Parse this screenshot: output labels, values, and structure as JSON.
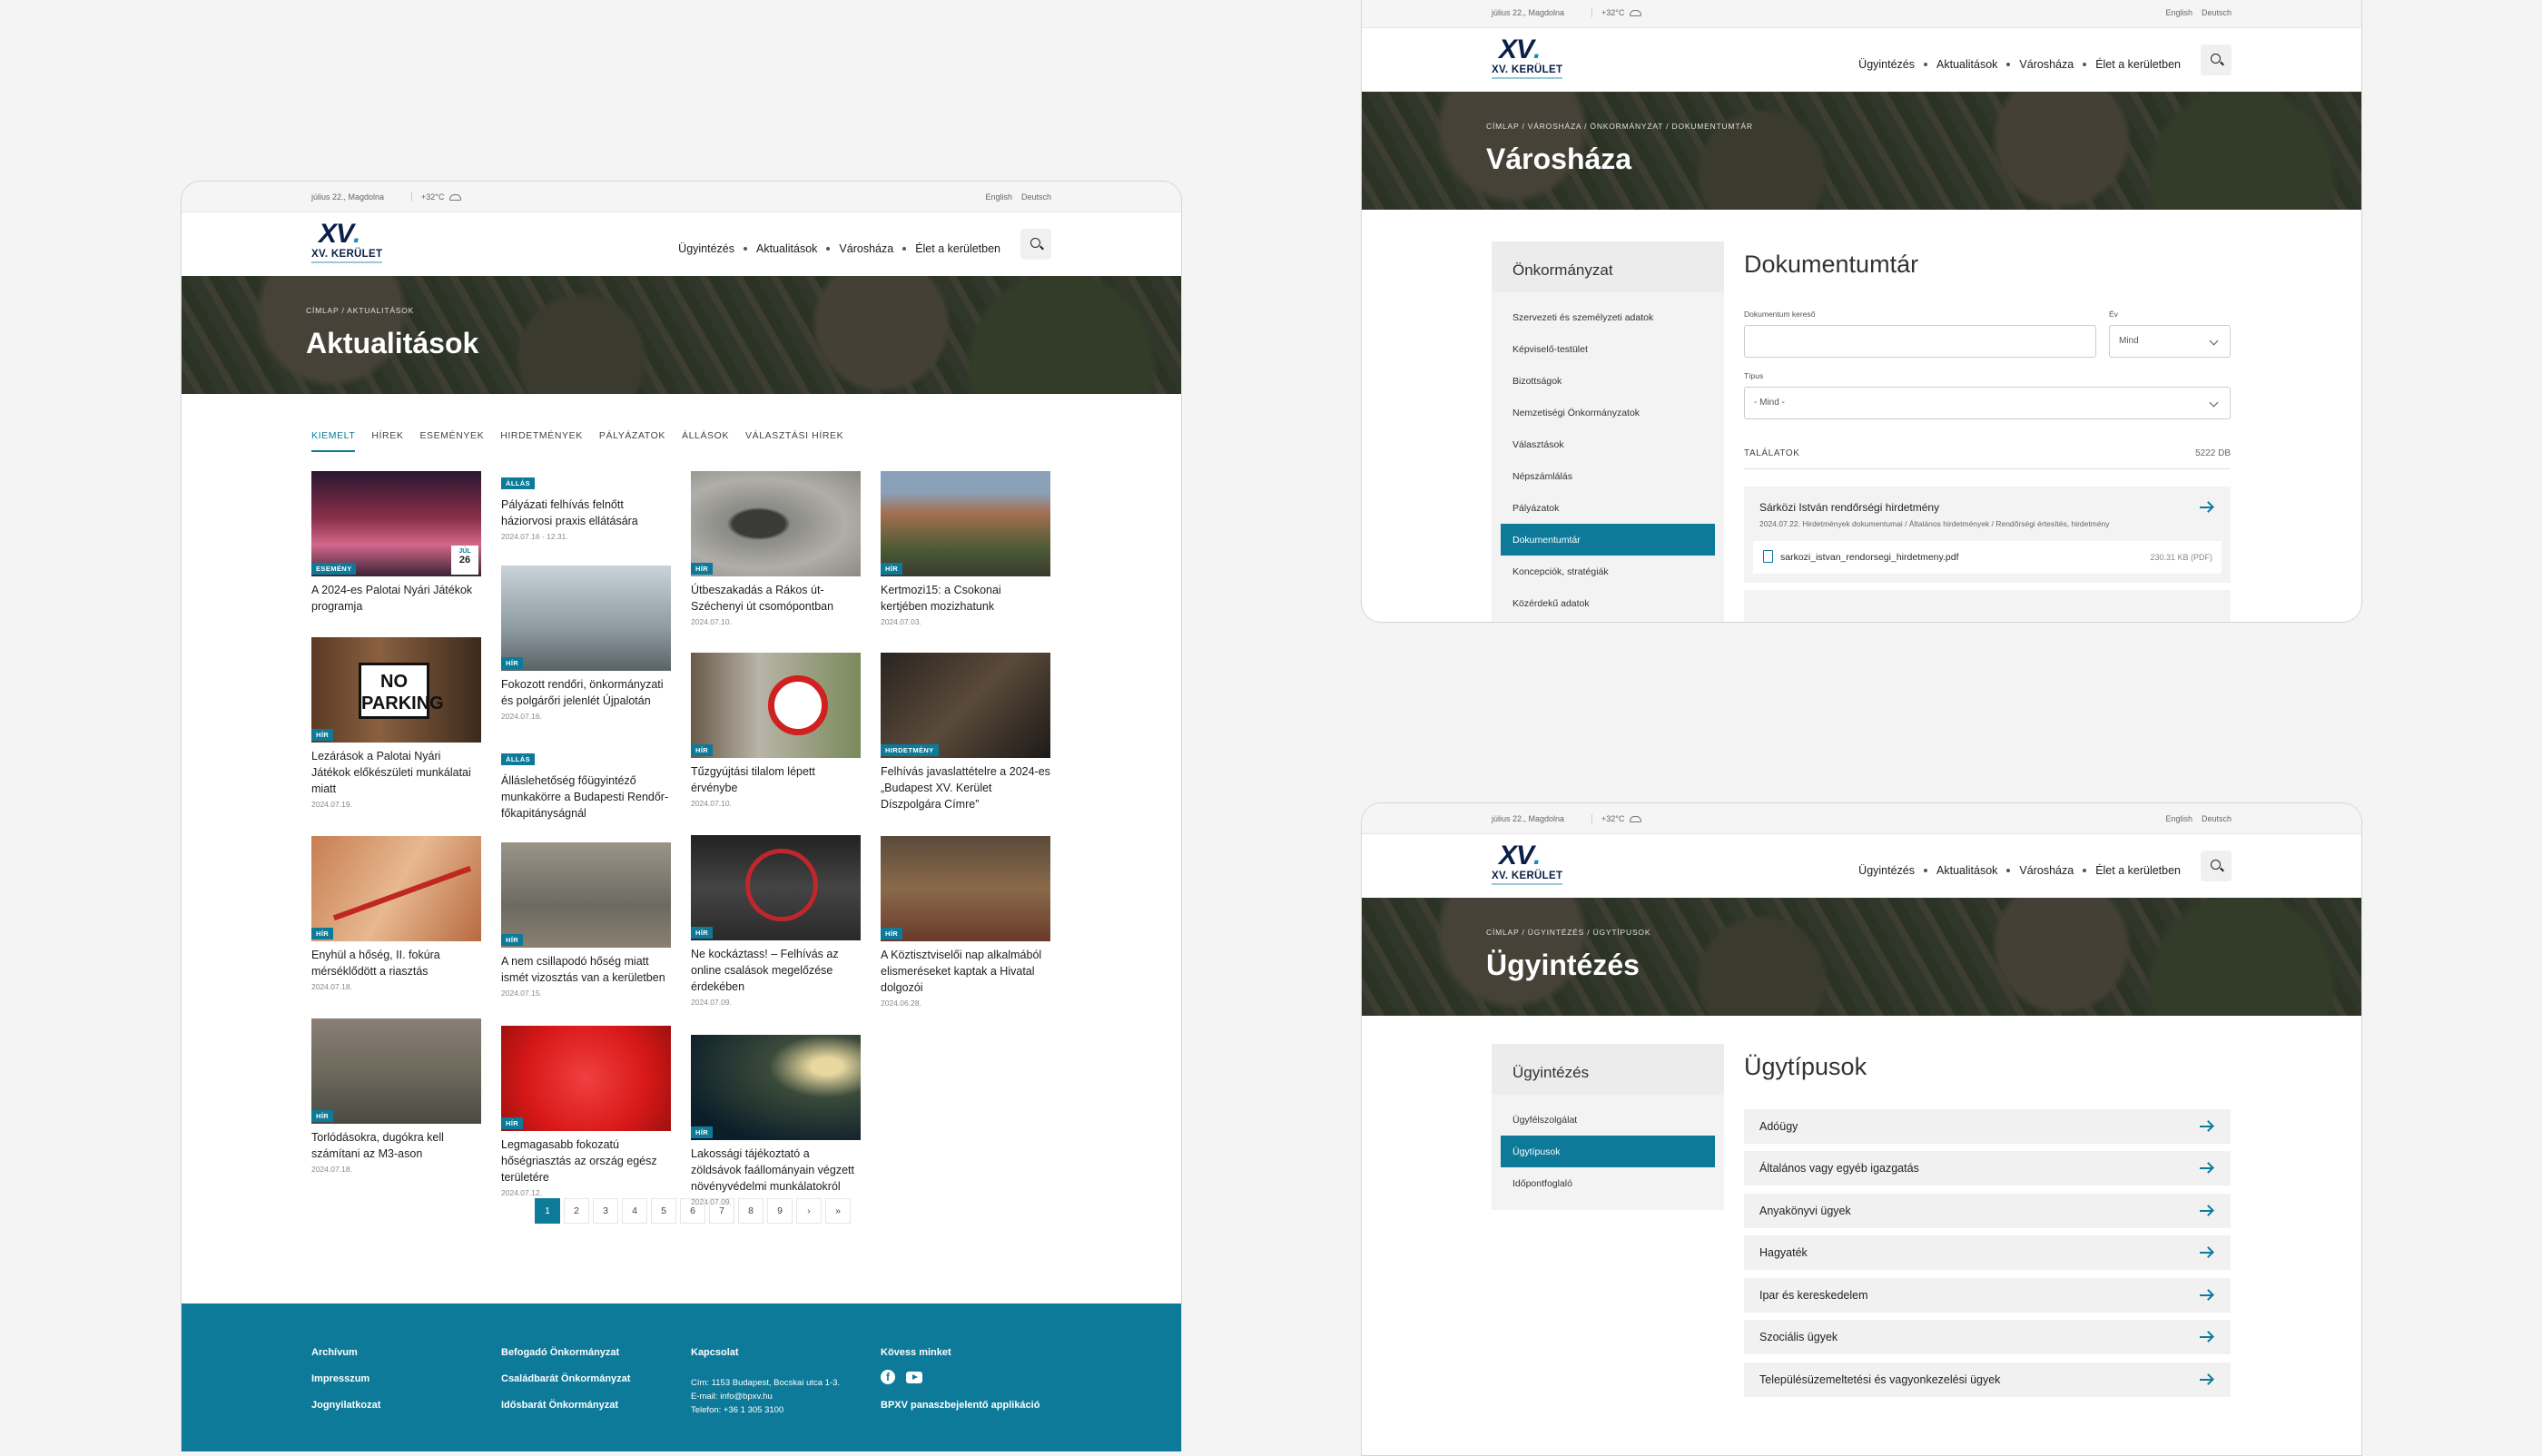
{
  "common": {
    "date": "július 22., Magdolna",
    "temp": "+32°C",
    "lang_en": "English",
    "lang_de": "Deutsch",
    "logo_top": "XV.",
    "logo_bottom": "XV. KERÜLET",
    "nav": [
      "Ügyintézés",
      "Aktualitások",
      "Városháza",
      "Élet a kerületben"
    ]
  },
  "news": {
    "crumb": "CÍMLAP  /  AKTUALITÁSOK",
    "title": "Aktualitások",
    "tabs": [
      "KIEMELT",
      "HÍREK",
      "ESEMÉNYEK",
      "HIRDETMÉNYEK",
      "PÁLYÁZATOK",
      "ÁLLÁSOK",
      "VÁLASZTÁSI HÍREK"
    ],
    "cards": [
      {
        "badge": "ESEMÉNY",
        "title": "A 2024-es Palotai Nyári Játékok programja",
        "date": "",
        "day_month": "JÚL",
        "day": "26"
      },
      {
        "badge": "HÍR",
        "title": "Lezárások a Palotai Nyári Játékok előkészületi munkálatai miatt",
        "date": "2024.07.19."
      },
      {
        "badge": "HÍR",
        "title": "Enyhül a hőség, II. fokúra mérséklődött a riasztás",
        "date": "2024.07.18."
      },
      {
        "badge": "HÍR",
        "title": "Torlódásokra, dugókra kell számítani az M3-ason",
        "date": "2024.07.18."
      },
      {
        "badge": "ÁLLÁS",
        "title": "Pályázati felhívás felnőtt háziorvosi praxis ellátására",
        "date": "2024.07.16 - 12.31."
      },
      {
        "badge": "HÍR",
        "title": "Fokozott rendőri, önkormányzati és polgárőri jelenlét Újpalotán",
        "date": "2024.07.16."
      },
      {
        "badge": "ÁLLÁS",
        "title": "Álláslehetőség főügyintéző munkakörre a Budapesti Rendőr-főkapitányságnál",
        "date": ""
      },
      {
        "badge": "HÍR",
        "title": "A nem csillapodó hőség miatt ismét vizosztás van a kerületben",
        "date": "2024.07.15."
      },
      {
        "badge": "HÍR",
        "title": "Legmagasabb fokozatú hőségriasztás az ország egész területére",
        "date": "2024.07.12."
      },
      {
        "badge": "HÍR",
        "title": "Útbeszakadás a Rákos út-Széchenyi út csomópontban",
        "date": "2024.07.10."
      },
      {
        "badge": "HÍR",
        "title": "Tűzgyújtási tilalom lépett érvénybe",
        "date": "2024.07.10."
      },
      {
        "badge": "HÍR",
        "title": "Ne kockáztass! – Felhívás az online csalások megelőzése érdekében",
        "date": "2024.07.09."
      },
      {
        "badge": "HÍR",
        "title": "Lakossági tájékoztató a zöldsávok faállományain végzett növényvédelmi munkálatokról",
        "date": "2024.07.09."
      },
      {
        "badge": "HÍR",
        "title": "Kertmozi15: a Csokonai kertjében mozizhatunk",
        "date": "2024.07.03."
      },
      {
        "badge": "HIRDETMÉNY",
        "title": "Felhívás javaslattételre a 2024-es „Budapest XV. Kerület Díszpolgára Címre”",
        "date": ""
      },
      {
        "badge": "HÍR",
        "title": "A Köztisztviselői nap alkalmából elismeréseket kaptak a Hivatal dolgozói",
        "date": "2024.06.28."
      }
    ],
    "no_parking": [
      "NO",
      "PARKING"
    ],
    "pages": [
      "1",
      "2",
      "3",
      "4",
      "5",
      "6",
      "7",
      "8",
      "9",
      "›",
      "»"
    ],
    "footer": {
      "col1": [
        "Archívum",
        "Impresszum",
        "Jognyilatkozat"
      ],
      "col2": [
        "Befogadó Önkormányzat",
        "Családbarát Önkormányzat",
        "Idősbarát Önkormányzat"
      ],
      "col3_title": "Kapcsolat",
      "col3_lines": [
        "Cím: 1153 Budapest, Bocskai utca 1-3.",
        "E-mail: info@bpxv.hu",
        "Telefon: +36 1 305 3100"
      ],
      "col4_title": "Kövess minket",
      "col4_app": "BPXV panaszbejelentő applikáció"
    }
  },
  "docs": {
    "crumb": "CÍMLAP  /  VÁROSHÁZA  /  ÖNKORMÁNYZAT  /  DOKUMENTUMTÁR",
    "title": "Városháza",
    "side_title": "Önkormányzat",
    "side_items": [
      "Szervezeti és személyzeti adatok",
      "Képviselő-testület",
      "Bizottságok",
      "Nemzetiségi Önkormányzatok",
      "Választások",
      "Népszámlálás",
      "Pályázatok",
      "Dokumentumtár",
      "Koncepciók, stratégiák",
      "Közérdekű adatok"
    ],
    "active_index": 7,
    "heading": "Dokumentumtár",
    "search_label": "Dokumentum kereső",
    "year_label": "Év",
    "year_value": "Mind",
    "type_label": "Típus",
    "type_value": "- Mind -",
    "results_label": "TALÁLATOK",
    "results_count": "5222 DB",
    "result_title": "Sárközi István rendőrségi hirdetmény",
    "result_meta": "2024.07.22.   Hirdetmények dokumentumai / Általános hirdetmények / Rendőrségi értesítés, hirdetmény",
    "file_name": "sarkozi_istvan_rendorsegi_hirdetmeny.pdf",
    "file_size": "230.31 KB (PDF)"
  },
  "admin": {
    "crumb": "CÍMLAP  /  ÜGYINTÉZÉS  /  ÜGYTÍPUSOK",
    "title": "Ügyintézés",
    "side_title": "Ügyintézés",
    "side_items": [
      "Ügyfélszolgálat",
      "Ügytípusok",
      "Időpontfoglaló"
    ],
    "active_index": 1,
    "heading": "Ügytípusok",
    "types": [
      "Adóügy",
      "Általános vagy egyéb igazgatás",
      "Anyakönyvi ügyek",
      "Hagyaték",
      "Ipar és kereskedelem",
      "Szociális ügyek",
      "Településüzemeltetési és vagyonkezelési ügyek"
    ]
  },
  "colors": {
    "accent": "#0d7a9a",
    "logo_navy": "#0a1e48"
  }
}
